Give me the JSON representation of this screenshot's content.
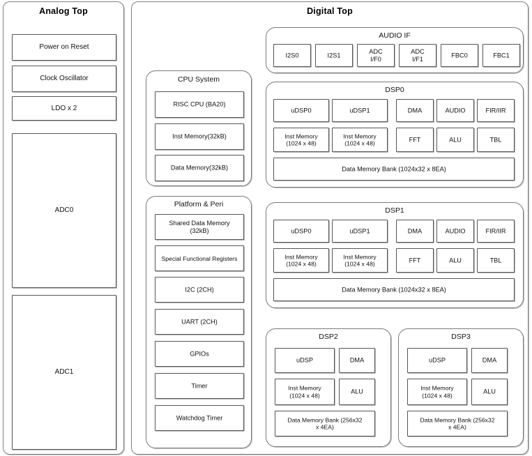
{
  "diagram": {
    "kind": "soc-block-diagram",
    "colors": {
      "background": "#ffffff",
      "block_fill": "#ffffff",
      "block_border": "#555555",
      "group_border": "#7a7a7a",
      "text": "#111111",
      "shadow": "#8c8c8c"
    }
  },
  "analog_top": {
    "title": "Analog Top",
    "blocks": [
      {
        "label": "Power on Reset"
      },
      {
        "label": "Clock Oscillator"
      },
      {
        "label": "LDO x 2"
      },
      {
        "label": "ADC0"
      },
      {
        "label": "ADC1"
      }
    ]
  },
  "digital_top": {
    "title": "Digital Top",
    "cpu_system": {
      "title": "CPU System",
      "blocks": [
        {
          "label": "RISC CPU (BA20)"
        },
        {
          "label": "Inst Memory(32kB)"
        },
        {
          "label": "Data Memory(32kB)"
        }
      ]
    },
    "platform_peri": {
      "title": "Platform & Peri",
      "blocks": [
        {
          "label": "Shared Data Memory\n(32kB)"
        },
        {
          "label": "Special Functional Registers"
        },
        {
          "label": "I2C (2CH)"
        },
        {
          "label": "UART (2CH)"
        },
        {
          "label": "GPIOs"
        },
        {
          "label": "Timer"
        },
        {
          "label": "Watchdog Timer"
        }
      ]
    },
    "audio_if": {
      "title": "AUDIO IF",
      "blocks": [
        {
          "label": "I2S0"
        },
        {
          "label": "I2S1"
        },
        {
          "label": "ADC\nI/F0"
        },
        {
          "label": "ADC\nI/F1"
        },
        {
          "label": "FBC0"
        },
        {
          "label": "FBC1"
        }
      ]
    },
    "dsp0": {
      "title": "DSP0",
      "row1": [
        {
          "label": "uDSP0"
        },
        {
          "label": "uDSP1"
        },
        {
          "label": "DMA"
        },
        {
          "label": "AUDIO"
        },
        {
          "label": "FIR/IIR"
        }
      ],
      "row2": [
        {
          "label": "Inst Memory\n(1024 x 48)"
        },
        {
          "label": "Inst Memory\n(1024 x 48)"
        },
        {
          "label": "FFT"
        },
        {
          "label": "ALU"
        },
        {
          "label": "TBL"
        }
      ],
      "bank": {
        "label": "Data Memory Bank (1024x32  x 8EA)"
      }
    },
    "dsp1": {
      "title": "DSP1",
      "row1": [
        {
          "label": "uDSP0"
        },
        {
          "label": "uDSP1"
        },
        {
          "label": "DMA"
        },
        {
          "label": "AUDIO"
        },
        {
          "label": "FIR/IIR"
        }
      ],
      "row2": [
        {
          "label": "Inst Memory\n(1024 x 48)"
        },
        {
          "label": "Inst Memory\n(1024 x 48)"
        },
        {
          "label": "FFT"
        },
        {
          "label": "ALU"
        },
        {
          "label": "TBL"
        }
      ],
      "bank": {
        "label": "Data Memory Bank (1024x32  x 8EA)"
      }
    },
    "dsp2": {
      "title": "DSP2",
      "row1": [
        {
          "label": "uDSP"
        },
        {
          "label": "DMA"
        }
      ],
      "row2": [
        {
          "label": "Inst Memory\n(1024 x 48)"
        },
        {
          "label": "ALU"
        }
      ],
      "bank": {
        "label": "Data Memory Bank (256x32\nx 4EA)"
      }
    },
    "dsp3": {
      "title": "DSP3",
      "row1": [
        {
          "label": "uDSP"
        },
        {
          "label": "DMA"
        }
      ],
      "row2": [
        {
          "label": "Inst Memory\n(1024 x 48)"
        },
        {
          "label": "ALU"
        }
      ],
      "bank": {
        "label": "Data Memory Bank (256x32\nx 4EA)"
      }
    }
  }
}
